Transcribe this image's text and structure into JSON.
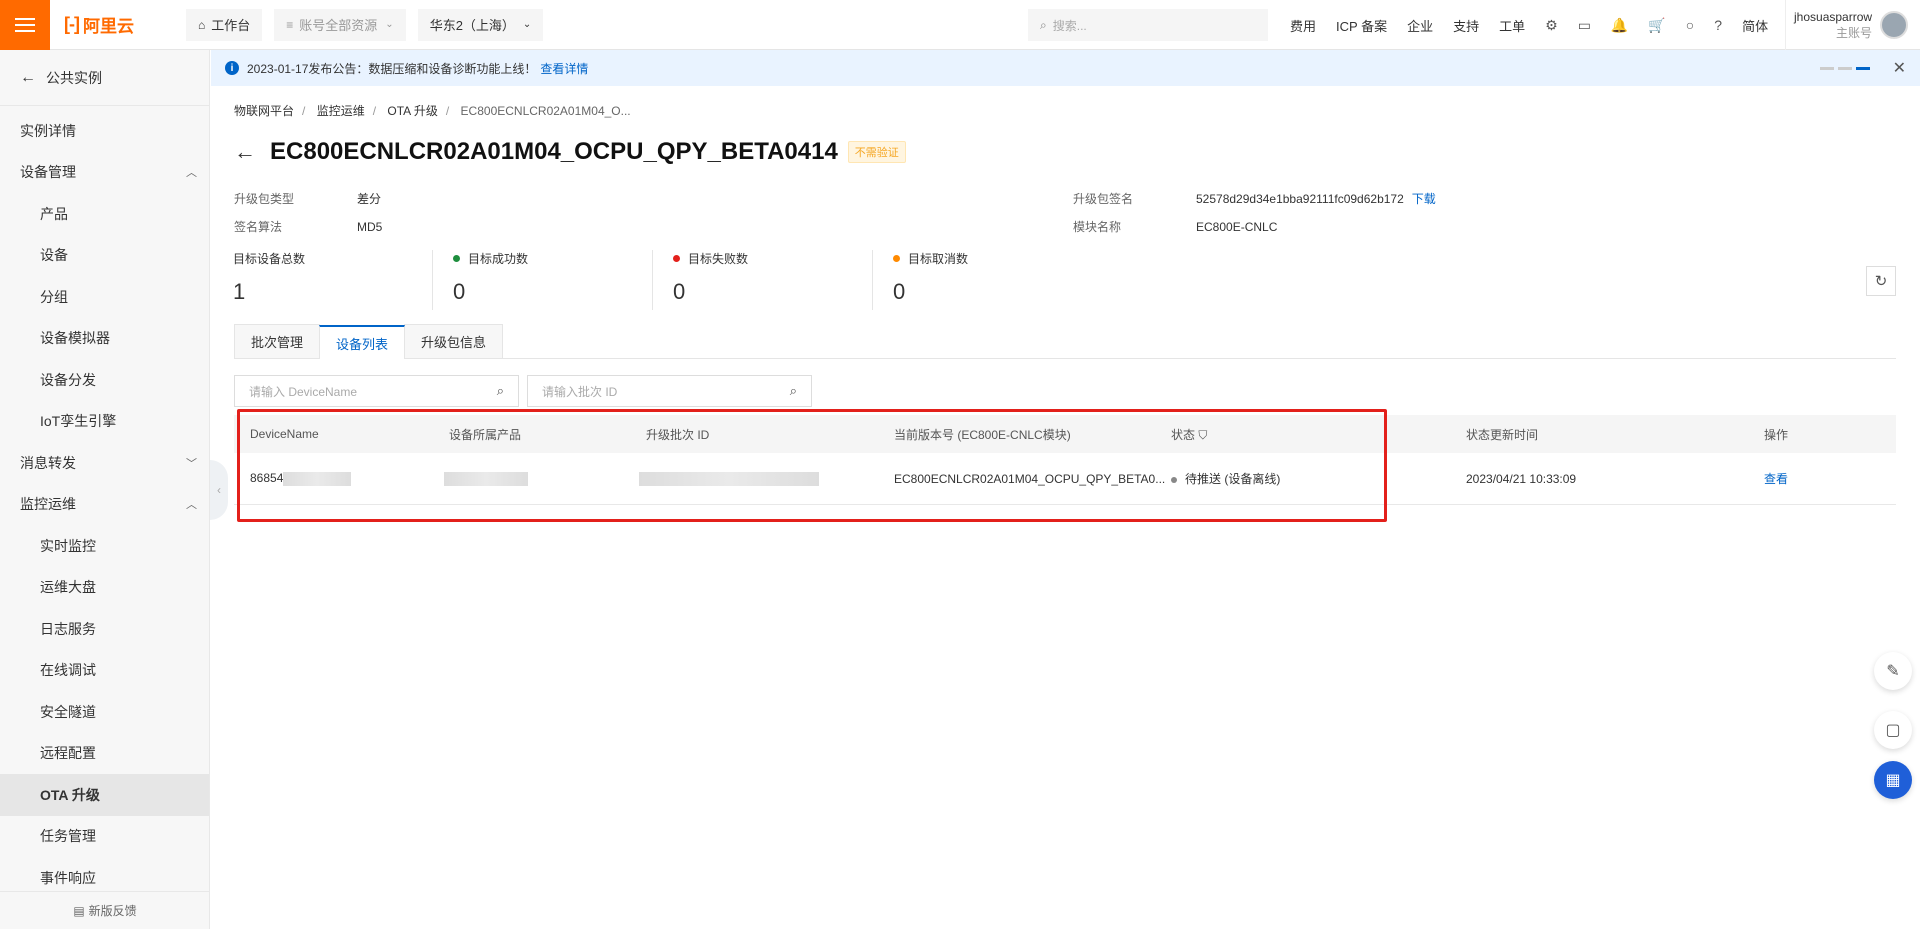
{
  "topbar": {
    "logo": "阿里云",
    "workbench": "工作台",
    "resources": "账号全部资源",
    "region": "华东2（上海）",
    "search_placeholder": "搜索...",
    "links": [
      "费用",
      "ICP 备案",
      "企业",
      "支持",
      "工单"
    ],
    "lang": "简体",
    "username": "jhosuasparrow",
    "account_type": "主账号"
  },
  "notice": {
    "text": "2023-01-17发布公告：数据压缩和设备诊断功能上线！",
    "link": "查看详情"
  },
  "sidebar": {
    "back": "公共实例",
    "items": [
      {
        "label": "实例详情",
        "level": 1
      },
      {
        "label": "设备管理",
        "level": 1,
        "chevron": "up"
      },
      {
        "label": "产品",
        "level": 2
      },
      {
        "label": "设备",
        "level": 2
      },
      {
        "label": "分组",
        "level": 2
      },
      {
        "label": "设备模拟器",
        "level": 2
      },
      {
        "label": "设备分发",
        "level": 2
      },
      {
        "label": "IoT孪生引擎",
        "level": 2
      },
      {
        "label": "消息转发",
        "level": 1,
        "chevron": "down"
      },
      {
        "label": "监控运维",
        "level": 1,
        "chevron": "up"
      },
      {
        "label": "实时监控",
        "level": 2
      },
      {
        "label": "运维大盘",
        "level": 2
      },
      {
        "label": "日志服务",
        "level": 2
      },
      {
        "label": "在线调试",
        "level": 2
      },
      {
        "label": "安全隧道",
        "level": 2
      },
      {
        "label": "远程配置",
        "level": 2
      },
      {
        "label": "OTA 升级",
        "level": 2,
        "active": true
      },
      {
        "label": "任务管理",
        "level": 2
      },
      {
        "label": "事件响应",
        "level": 2
      }
    ],
    "feedback": "新版反馈"
  },
  "breadcrumb": [
    "物联网平台",
    "监控运维",
    "OTA 升级",
    "EC800ECNLCR02A01M04_O..."
  ],
  "page": {
    "title": "EC800ECNLCR02A01M04_OCPU_QPY_BETA0414",
    "tag": "不需验证",
    "meta": {
      "pkg_type_label": "升级包类型",
      "pkg_type": "差分",
      "sign_algo_label": "签名算法",
      "sign_algo": "MD5",
      "pkg_sign_label": "升级包签名",
      "pkg_sign": "52578d29d34e1bba92111fc09d62b172",
      "download": "下载",
      "module_label": "模块名称",
      "module": "EC800E-CNLC"
    },
    "stats": [
      {
        "label": "目标设备总数",
        "value": "1",
        "color": ""
      },
      {
        "label": "目标成功数",
        "value": "0",
        "color": "#1e8e3e"
      },
      {
        "label": "目标失败数",
        "value": "0",
        "color": "#e3201b"
      },
      {
        "label": "目标取消数",
        "value": "0",
        "color": "#ff8a00"
      }
    ],
    "tabs": [
      "批次管理",
      "设备列表",
      "升级包信息"
    ],
    "active_tab": 1,
    "search_device_placeholder": "请输入 DeviceName",
    "search_batch_placeholder": "请输入批次 ID"
  },
  "table": {
    "headers": [
      "DeviceName",
      "设备所属产品",
      "升级批次 ID",
      "当前版本号 (EC800E-CNLC模块)",
      "状态",
      "状态更新时间",
      "操作"
    ],
    "rows": [
      {
        "device": "86854",
        "product": "",
        "batch": "",
        "version": "EC800ECNLCR02A01M04_OCPU_QPY_BETA0...",
        "status": "待推送 (设备离线)",
        "updated": "2023/04/21 10:33:09",
        "action": "查看"
      }
    ]
  }
}
